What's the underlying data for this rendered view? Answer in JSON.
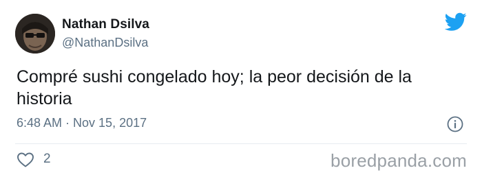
{
  "author": {
    "display_name": "Nathan Dsilva",
    "handle": "@NathanDsilva"
  },
  "tweet": {
    "text": "Compré sushi congelado hoy; la peor decisión de la historia",
    "timestamp": "6:48 AM · Nov 15, 2017",
    "likes": "2"
  },
  "watermark": "boredpanda.com",
  "colors": {
    "twitter_blue": "#1da1f2",
    "secondary_text": "#5b7083",
    "watermark": "#9aa0a6"
  },
  "icons": {
    "brand": "twitter-bird-icon",
    "info": "info-icon",
    "like": "heart-outline-icon"
  }
}
